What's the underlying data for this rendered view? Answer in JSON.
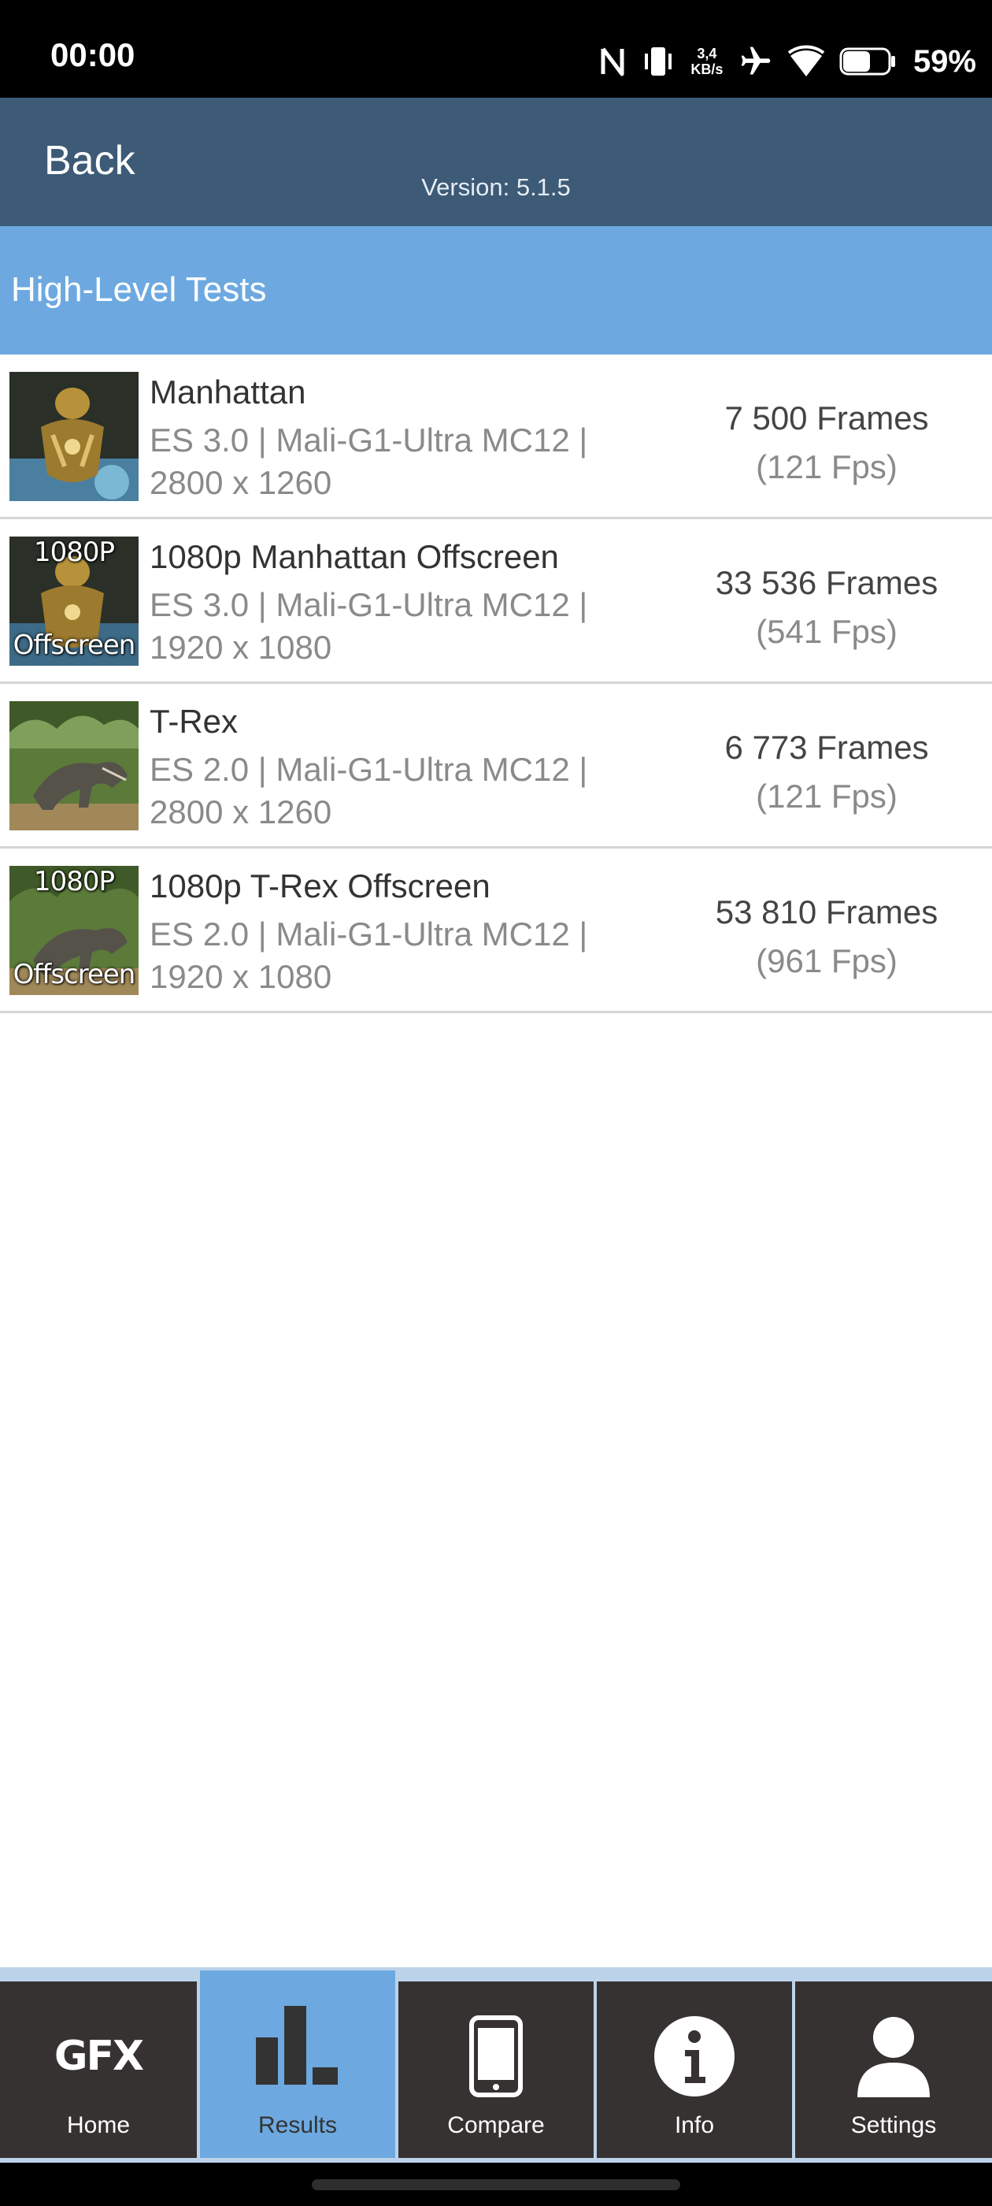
{
  "status_bar": {
    "time": "00:00",
    "net_speed_value": "3,4",
    "net_speed_unit": "KB/s",
    "battery_percent": "59%",
    "icons": [
      "nfc-icon",
      "vibrate-icon",
      "airplane-icon",
      "wifi-icon",
      "battery-icon"
    ]
  },
  "header": {
    "back_label": "Back",
    "version": "Version: 5.1.5"
  },
  "section": {
    "title": "High-Level Tests"
  },
  "tests": [
    {
      "name": "Manhattan",
      "api_gpu": "ES 3.0 | Mali-G1-Ultra MC12 |",
      "resolution": "2800 x 1260",
      "frames": "7 500 Frames",
      "fps": "(121 Fps)",
      "thumb_top": "",
      "thumb_bottom": ""
    },
    {
      "name": "1080p Manhattan Offscreen",
      "api_gpu": "ES 3.0 | Mali-G1-Ultra MC12 |",
      "resolution": "1920 x 1080",
      "frames": "33 536 Frames",
      "fps": "(541 Fps)",
      "thumb_top": "1080P",
      "thumb_bottom": "Offscreen"
    },
    {
      "name": "T-Rex",
      "api_gpu": "ES 2.0 | Mali-G1-Ultra MC12 |",
      "resolution": "2800 x 1260",
      "frames": "6 773 Frames",
      "fps": "(121 Fps)",
      "thumb_top": "",
      "thumb_bottom": ""
    },
    {
      "name": "1080p T-Rex Offscreen",
      "api_gpu": "ES 2.0 | Mali-G1-Ultra MC12 |",
      "resolution": "1920 x 1080",
      "frames": "53 810 Frames",
      "fps": "(961 Fps)",
      "thumb_top": "1080P",
      "thumb_bottom": "Offscreen"
    }
  ],
  "bottom_nav": {
    "items": [
      {
        "label": "Home",
        "logo": "GFX",
        "icon": "gfx-logo-icon",
        "active": false
      },
      {
        "label": "Results",
        "icon": "bar-chart-icon",
        "active": true
      },
      {
        "label": "Compare",
        "icon": "phone-icon",
        "active": false
      },
      {
        "label": "Info",
        "icon": "info-icon",
        "active": false
      },
      {
        "label": "Settings",
        "icon": "user-icon",
        "active": false
      }
    ]
  },
  "colors": {
    "status_bar": "#000000",
    "header": "#3d5a76",
    "section_bar": "#6da9e0",
    "nav_bg": "#353231",
    "nav_active": "#6da9e0"
  }
}
